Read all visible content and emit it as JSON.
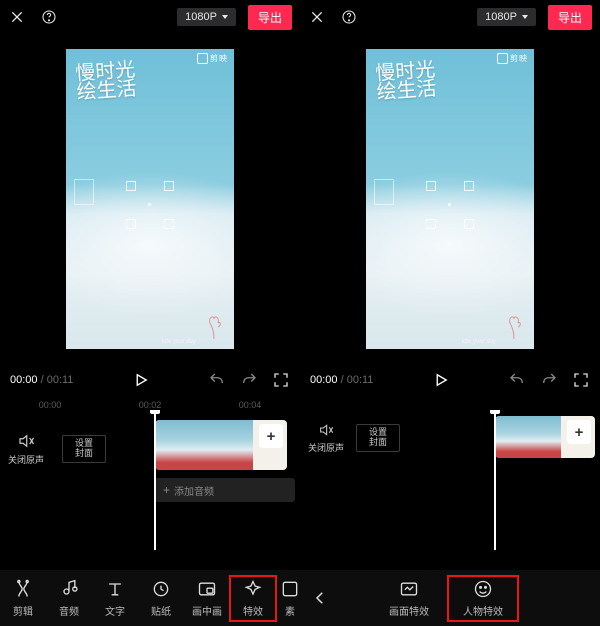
{
  "shared": {
    "resolution": "1080P",
    "export": "导出",
    "brand": "剪映",
    "title_text": "慢时光\n绘生活",
    "signature": "Idle your day",
    "time_current": "00:00",
    "time_duration": "00:11"
  },
  "ruler": [
    "00:00",
    "00:02",
    "00:04"
  ],
  "timeline": {
    "mute_label": "关闭原声",
    "cover_label": "设置\n封面",
    "add_audio": "添加音频",
    "plus": "+"
  },
  "left_tools": [
    {
      "key": "edit",
      "label": "剪辑"
    },
    {
      "key": "audio",
      "label": "音频"
    },
    {
      "key": "text",
      "label": "文字"
    },
    {
      "key": "sticker",
      "label": "贴纸"
    },
    {
      "key": "pip",
      "label": "画中画"
    },
    {
      "key": "fx",
      "label": "特效"
    },
    {
      "key": "material",
      "label": "素"
    }
  ],
  "right_tools": [
    {
      "key": "screen-fx",
      "label": "画面特效"
    },
    {
      "key": "person-fx",
      "label": "人物特效"
    }
  ]
}
